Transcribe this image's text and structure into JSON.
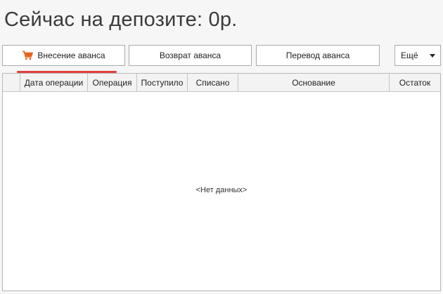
{
  "header": {
    "title": "Сейчас на депозите: 0р."
  },
  "toolbar": {
    "deposit_label": "Внесение аванса",
    "refund_label": "Возврат аванса",
    "transfer_label": "Перевод аванса",
    "more_label": "Ещё"
  },
  "table": {
    "columns": [
      "",
      "Дата операции",
      "Операция",
      "Поступило",
      "Списано",
      "Основание",
      "Остаток"
    ],
    "empty_text": "<Нет данных>"
  },
  "colors": {
    "accent": "#e0403a",
    "cart_icon": "#e8641e"
  },
  "icons": {
    "deposit": "cart-icon",
    "more": "chevron-down-icon"
  }
}
